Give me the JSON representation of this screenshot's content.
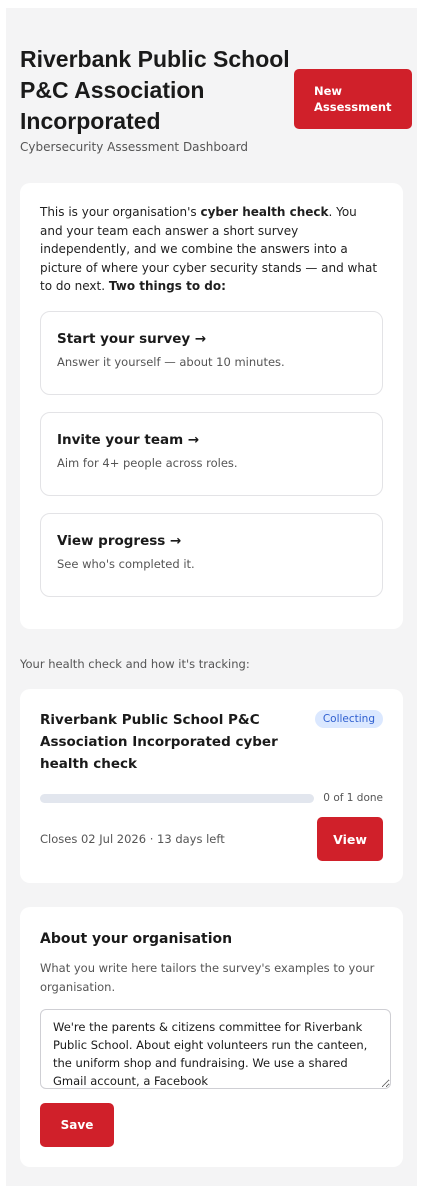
{
  "header": {
    "org_name": "Riverbank Public School P&C Association Incorporated",
    "subtitle": "Cybersecurity Assessment Dashboard",
    "new_assessment_label": "New Assessment"
  },
  "intro": {
    "text_before_bold": "This is your organisation's ",
    "bold_phrase": "cyber health check",
    "text_after_bold": ". You and your team each answer a short survey independently, and we combine the answers into a picture of where your cyber security stands — and what to do next. ",
    "bold_tail": "Two things to do:",
    "steps": [
      {
        "title": "Start your survey →",
        "desc": "Answer it yourself — about 10 minutes."
      },
      {
        "title": "Invite your team →",
        "desc": "Aim for 4+ people across roles."
      },
      {
        "title": "View progress →",
        "desc": "See who's completed it."
      }
    ]
  },
  "health": {
    "section_label": "Your health check and how it's tracking:",
    "title": "Riverbank Public School P&C Association Incorporated cyber health check",
    "status": "Collecting",
    "progress_fraction": 0,
    "progress_text": "0 of 1 done",
    "closes_text": "Closes 02 Jul 2026 · 13 days left",
    "view_label": "View"
  },
  "about": {
    "title": "About your organisation",
    "desc": "What you write here tailors the survey's examples to your organisation.",
    "value": "We're the parents & citizens committee for Riverbank Public School. About eight volunteers run the canteen, the uniform shop and fundraising. We use a shared Gmail account, a Facebook",
    "save_label": "Save"
  },
  "colors": {
    "accent": "#d0202a",
    "badge_bg": "#dbe8ff",
    "badge_text": "#2f5fd0",
    "page_bg": "#f4f4f5"
  }
}
